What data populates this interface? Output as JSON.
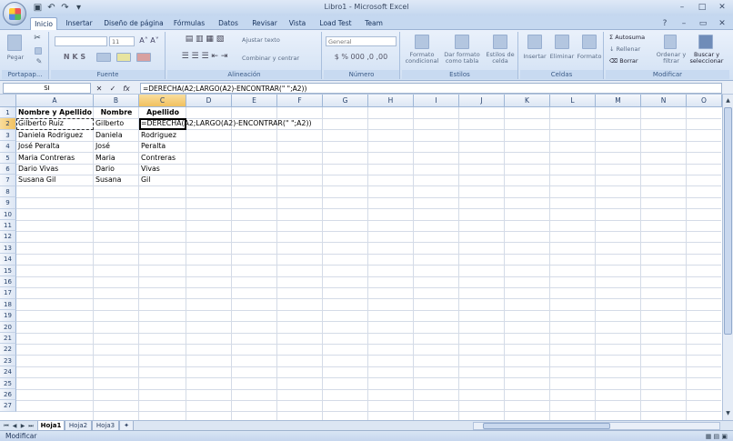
{
  "window": {
    "title": "Libro1 - Microsoft Excel",
    "controls": [
      "–",
      "□",
      "✕"
    ]
  },
  "tabs": [
    {
      "label": "Inicio",
      "active": true
    },
    {
      "label": "Insertar"
    },
    {
      "label": "Diseño de página"
    },
    {
      "label": "Fórmulas"
    },
    {
      "label": "Datos"
    },
    {
      "label": "Revisar"
    },
    {
      "label": "Vista"
    },
    {
      "label": "Load Test"
    },
    {
      "label": "Team"
    }
  ],
  "ribbon": {
    "clipboard": {
      "paste": "Pegar",
      "label": "Portapap..."
    },
    "font": {
      "font_size": "11",
      "label": "Fuente"
    },
    "alignment": {
      "wrap": "Ajustar texto",
      "merge": "Combinar y centrar",
      "label": "Alineación"
    },
    "number": {
      "format": "General",
      "label": "Número"
    },
    "styles": {
      "conditional": "Formato condicional",
      "table": "Dar formato como tabla",
      "cell_styles": "Estilos de celda",
      "label": "Estilos"
    },
    "cells": {
      "insert": "Insertar",
      "delete": "Eliminar",
      "format": "Formato",
      "label": "Celdas"
    },
    "editing": {
      "autosum": "Autosuma",
      "fill": "Rellenar",
      "clear": "Borrar",
      "sort": "Ordenar y filtrar",
      "find": "Buscar y seleccionar",
      "label": "Modificar"
    }
  },
  "formula_bar": {
    "name_box": "SI",
    "formula": "=DERECHA(A2;LARGO(A2)-ENCONTRAR(\" \";A2))"
  },
  "columns": [
    "A",
    "B",
    "C",
    "D",
    "E",
    "F",
    "G",
    "H",
    "I",
    "J",
    "K",
    "L",
    "M",
    "N",
    "O"
  ],
  "rows": [
    "1",
    "2",
    "3",
    "4",
    "5",
    "6",
    "7",
    "8",
    "9",
    "10",
    "11",
    "12",
    "13",
    "14",
    "15",
    "16",
    "17",
    "18",
    "19",
    "20",
    "21",
    "22",
    "23",
    "24",
    "25",
    "26",
    "27"
  ],
  "cells": {
    "headers": [
      "Nombre y Apellido",
      "Nombre",
      "Apellido"
    ],
    "data": [
      [
        "Gilberto Ruiz",
        "Gilberto",
        "=DERECHA(A2;LARGO(A2)-ENCONTRAR(\" \";A2))"
      ],
      [
        "Daniela Rodriguez",
        "Daniela",
        "Rodriguez"
      ],
      [
        "José Peralta",
        "José",
        "Peralta"
      ],
      [
        "Maria Contreras",
        "Maria",
        "Contreras"
      ],
      [
        "Dario Vivas",
        "Dario",
        "Vivas"
      ],
      [
        "Susana Gil",
        "Susana",
        "Gil"
      ]
    ]
  },
  "sheets": [
    {
      "label": "Hoja1",
      "active": true
    },
    {
      "label": "Hoja2"
    },
    {
      "label": "Hoja3"
    }
  ],
  "status": {
    "mode": "Modificar"
  }
}
